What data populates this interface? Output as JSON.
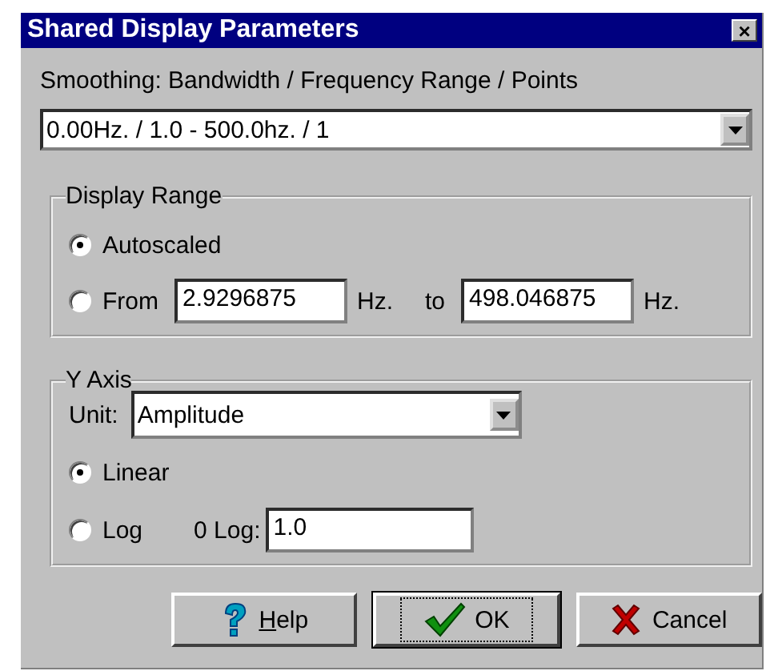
{
  "window": {
    "title": "Shared Display Parameters",
    "close_label": "×"
  },
  "smoothing": {
    "label": "Smoothing: Bandwidth / Frequency Range / Points",
    "value": "0.00Hz. / 1.0 - 500.0hz. / 1"
  },
  "display_range": {
    "title": "Display Range",
    "options": [
      {
        "label": "Autoscaled",
        "selected": true,
        "kind": "plain"
      },
      {
        "label": "From",
        "selected": false,
        "kind": "range",
        "from": "2.9296875",
        "from_unit": "Hz.",
        "to_label": "to",
        "to": "498.046875",
        "to_unit": "Hz."
      }
    ]
  },
  "y_axis": {
    "title": "Y Axis",
    "unit_label": "Unit:",
    "unit": "Amplitude",
    "options": [
      {
        "label": "Linear",
        "selected": true,
        "kind": "plain"
      },
      {
        "label": "Log",
        "selected": false,
        "kind": "log",
        "field_label": "0 Log:",
        "field_value": "1.0"
      }
    ]
  },
  "buttons": [
    {
      "label": "Help",
      "kind": "help",
      "mnemonic_first": true,
      "default": false
    },
    {
      "label": "OK",
      "kind": "ok",
      "default": true
    },
    {
      "label": "Cancel",
      "kind": "cancel",
      "default": false
    }
  ]
}
